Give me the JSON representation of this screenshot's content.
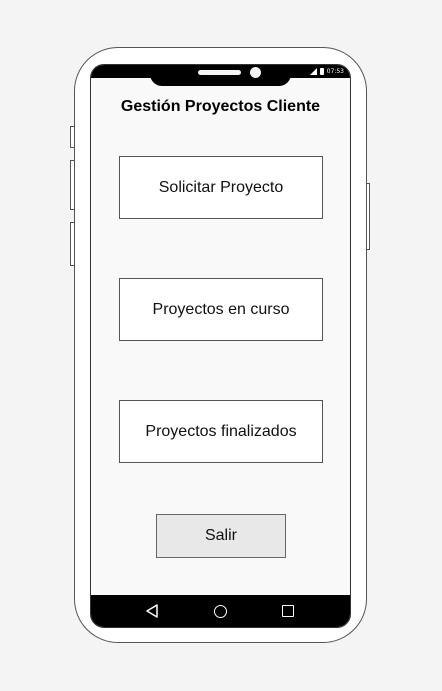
{
  "status_bar": {
    "time": "07:53",
    "icons": [
      "signal-icon",
      "battery-icon"
    ]
  },
  "screen": {
    "title": "Gestión Proyectos Cliente",
    "buttons": {
      "solicitar": "Solicitar Proyecto",
      "en_curso": "Proyectos en curso",
      "finalizados": "Proyectos finalizados",
      "salir": "Salir"
    }
  },
  "nav_bar": {
    "icons": [
      "back-icon",
      "home-icon",
      "recent-apps-icon"
    ]
  },
  "colors": {
    "background": "#f4f4f4",
    "screen": "#f9f9f9",
    "exit_button": "#e8e8e8",
    "bars": "#000000"
  }
}
